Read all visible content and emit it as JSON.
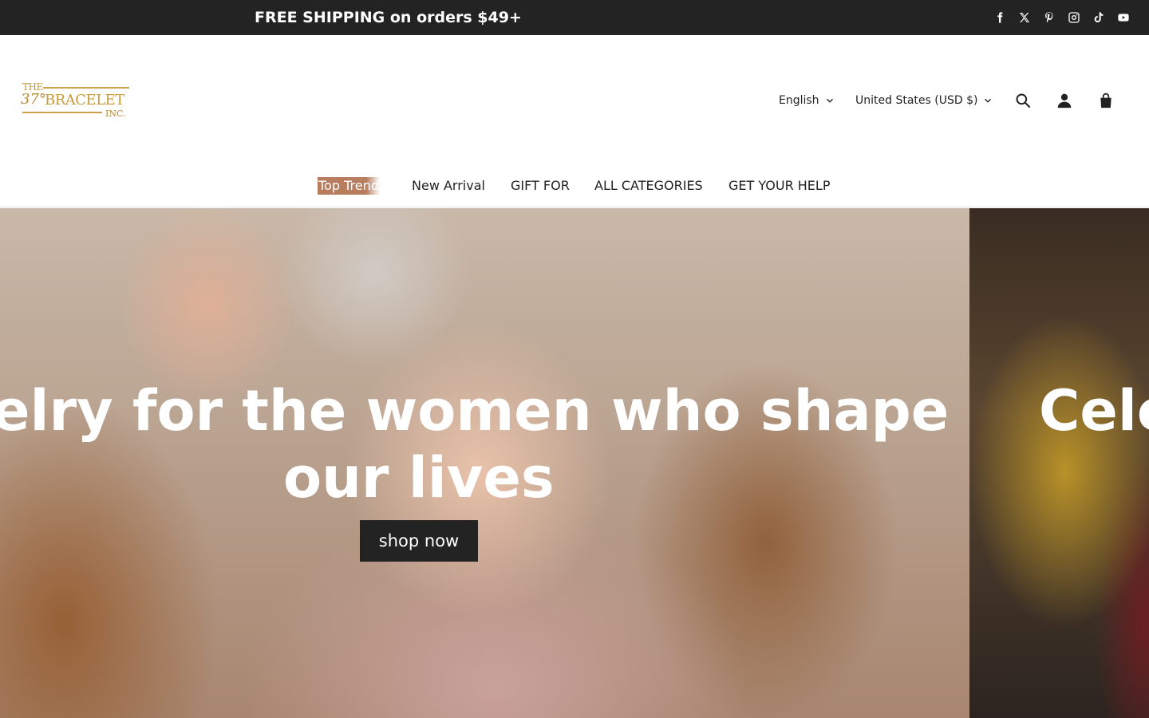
{
  "announcement": {
    "text": "FREE SHIPPING on orders $49+",
    "social_icons": [
      "facebook-icon",
      "x-twitter-icon",
      "pinterest-icon",
      "instagram-icon",
      "tiktok-icon",
      "youtube-icon"
    ]
  },
  "header": {
    "logo": {
      "the": "THE",
      "number": "37°",
      "name": "BRACELET",
      "inc": "INC."
    },
    "language": "English",
    "currency": "United States (USD $)",
    "icons": [
      "search-icon",
      "account-icon",
      "cart-icon"
    ]
  },
  "nav": {
    "items": [
      {
        "label": "Top Trend"
      },
      {
        "label": "New Arrival"
      },
      {
        "label": "GIFT FOR"
      },
      {
        "label": "ALL CATEGORIES"
      },
      {
        "label": "GET YOUR HELP"
      }
    ]
  },
  "hero": {
    "slide1": {
      "line1": "elry for the women who shape",
      "line2": "our lives",
      "button": "shop now"
    },
    "slide2": {
      "heading": "Cele"
    }
  },
  "colors": {
    "announcement_bg": "#232323",
    "brand_gold": "#c99b3a",
    "top_trend_bg": "#b87c5e",
    "button_bg": "#232323"
  }
}
